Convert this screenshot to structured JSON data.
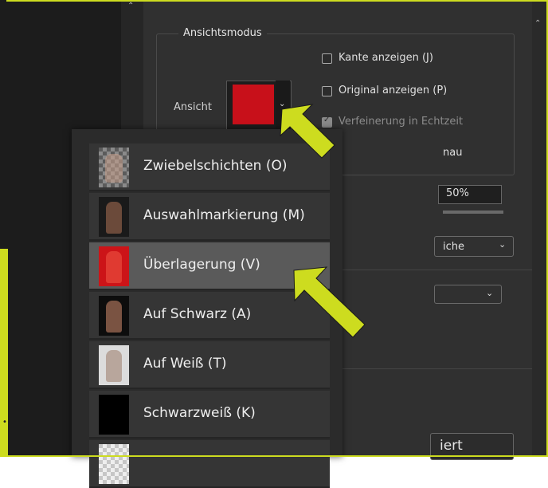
{
  "panel": {
    "section_title": "Ansichtsmodus",
    "view_label": "Ansicht",
    "checkboxes": [
      {
        "label": "Kante anzeigen (J)",
        "checked": false,
        "disabled": false
      },
      {
        "label": "Original anzeigen (P)",
        "checked": false,
        "disabled": false
      },
      {
        "label": "Verfeinerung in Echtzeit",
        "checked": true,
        "disabled": true
      },
      {
        "label": "nau",
        "checked": false,
        "disabled": false
      }
    ],
    "opacity_value": "50%",
    "select_value": "iche",
    "button_partial_label": "iert"
  },
  "menu": {
    "items": [
      {
        "label": "Zwiebelschichten (O)",
        "thumb": "onion-skin",
        "selected": false
      },
      {
        "label": "Auswahlmarkierung (M)",
        "thumb": "marching-ants",
        "selected": false
      },
      {
        "label": "Überlagerung (V)",
        "thumb": "overlay",
        "selected": true
      },
      {
        "label": "Auf Schwarz (A)",
        "thumb": "on-black",
        "selected": false
      },
      {
        "label": "Auf Weiß (T)",
        "thumb": "on-white",
        "selected": false
      },
      {
        "label": "Schwarzweiß (K)",
        "thumb": "black-white",
        "selected": false
      },
      {
        "label": "",
        "thumb": "on-layers",
        "selected": false
      }
    ]
  },
  "icons": {
    "dropdown_arrow": "chevron-down-icon",
    "scroll_up": "chevron-up-icon",
    "annotation_arrow": "arrow-icon"
  },
  "colors": {
    "annotation": "#cddc1f",
    "overlay_red": "#cc1418",
    "selected_row": "#5a5a5a"
  }
}
